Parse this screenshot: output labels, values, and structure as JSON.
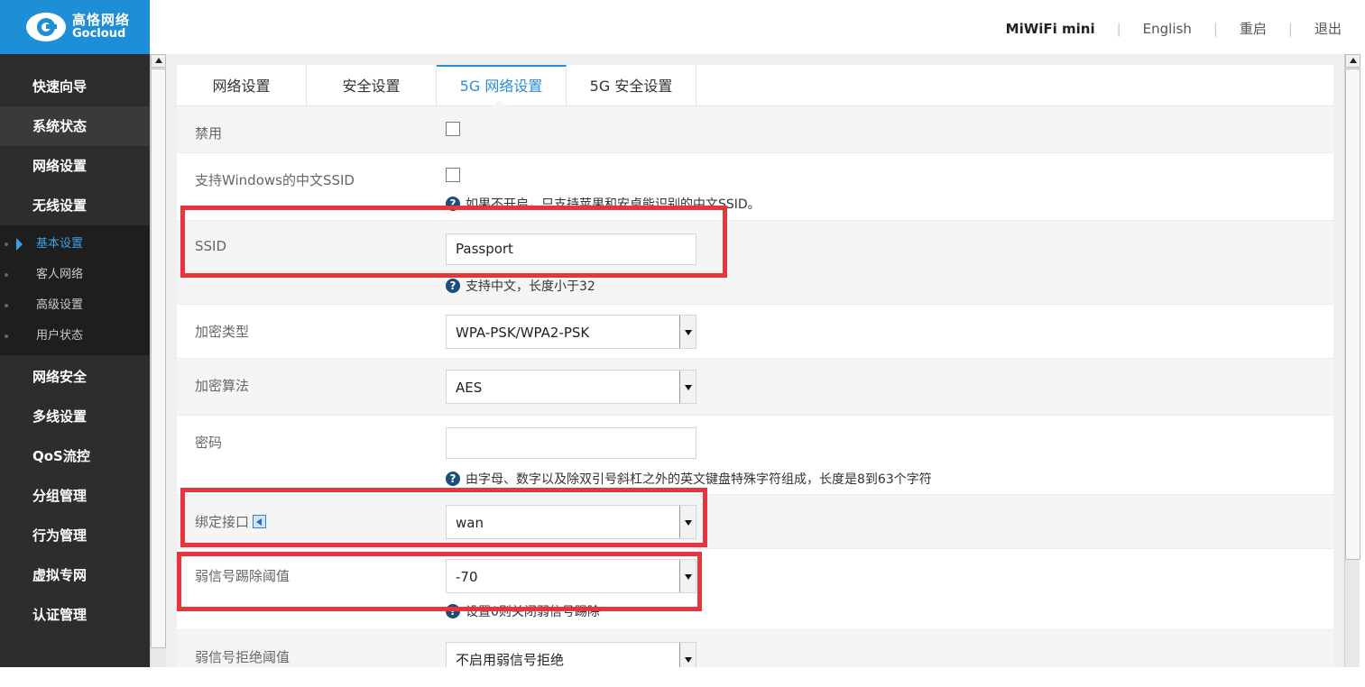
{
  "logo": {
    "cn": "高恪网络",
    "en": "Gocloud"
  },
  "topnav": {
    "brand": "MiWiFi mini",
    "lang": "English",
    "reboot": "重启",
    "logout": "退出"
  },
  "sidebar": {
    "items": [
      {
        "label": "快速向导"
      },
      {
        "label": "系统状态"
      },
      {
        "label": "网络设置"
      },
      {
        "label": "无线设置"
      }
    ],
    "sub_items": [
      {
        "label": "基本设置",
        "active": true
      },
      {
        "label": "客人网络"
      },
      {
        "label": "高级设置"
      },
      {
        "label": "用户状态"
      }
    ],
    "items_after": [
      {
        "label": "网络安全"
      },
      {
        "label": "多线设置"
      },
      {
        "label": "QoS流控"
      },
      {
        "label": "分组管理"
      },
      {
        "label": "行为管理"
      },
      {
        "label": "虚拟专网"
      },
      {
        "label": "认证管理"
      }
    ]
  },
  "tabs": [
    {
      "label": "网络设置"
    },
    {
      "label": "安全设置"
    },
    {
      "label": "5G 网络设置",
      "active": true
    },
    {
      "label": "5G 安全设置"
    }
  ],
  "form": {
    "disable": {
      "label": "禁用"
    },
    "cn_ssid": {
      "label": "支持Windows的中文SSID",
      "hint": "如果不开启，只支持苹果和安卓能识别的中文SSID。"
    },
    "ssid": {
      "label": "SSID",
      "value": "Passport",
      "hint": "支持中文，长度小于32"
    },
    "enc_type": {
      "label": "加密类型",
      "value": "WPA-PSK/WPA2-PSK"
    },
    "enc_algo": {
      "label": "加密算法",
      "value": "AES"
    },
    "password": {
      "label": "密码",
      "value": "",
      "hint": "由字母、数字以及除双引号斜杠之外的英文键盘特殊字符组成，长度是8到63个字符"
    },
    "bind_iface": {
      "label": "绑定接口",
      "value": "wan"
    },
    "kick_threshold": {
      "label": "弱信号踢除阈值",
      "value": "-70",
      "hint": "设置0则关闭弱信号踢除"
    },
    "reject_threshold": {
      "label": "弱信号拒绝阈值",
      "value": "不启用弱信号拒绝"
    }
  },
  "colors": {
    "accent": "#2a8fd8",
    "highlight": "#e8343c",
    "sidebar": "#2d2d2d",
    "logo_bg": "#1e8fd6"
  }
}
